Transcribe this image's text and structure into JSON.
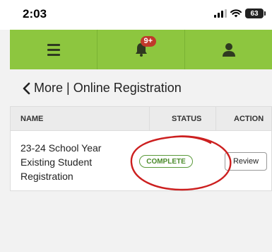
{
  "status_bar": {
    "time": "2:03",
    "battery": "63",
    "icons": [
      "signal-icon",
      "wifi-icon",
      "battery-icon"
    ]
  },
  "nav": {
    "menu_icon": "hamburger-icon",
    "notification_icon": "bell-icon",
    "notification_badge": "9+",
    "profile_icon": "user-icon",
    "accent_color": "#8dc63f",
    "badge_color": "#c0392b"
  },
  "header": {
    "back_icon": "chevron-left-icon",
    "title": "More | Online Registration"
  },
  "table": {
    "columns": [
      "NAME",
      "STATUS",
      "ACTION"
    ],
    "rows": [
      {
        "name": "23-24 School Year Existing Student Registration",
        "status": "COMPLETE",
        "action": "Review"
      }
    ]
  },
  "annotation": {
    "color": "#cc1f1f"
  }
}
